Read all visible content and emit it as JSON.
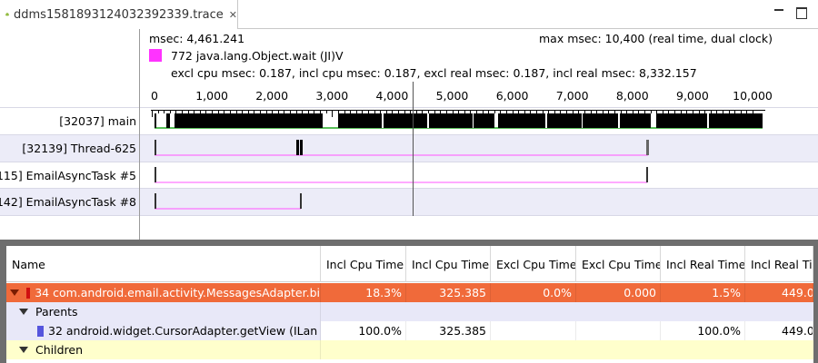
{
  "tab": {
    "title": "ddms1581893124032392339.trace",
    "close_glyph": "✕"
  },
  "info": {
    "msec": "msec: 4,461.241",
    "max_msec": "max msec: 10,400 (real time, dual clock)",
    "method": "772 java.lang.Object.wait (JI)V",
    "method_color": "#ff33ff",
    "stats": "excl cpu msec: 0.187, incl cpu msec: 0.187, excl real msec: 0.187, incl real msec: 8,332.157"
  },
  "ruler": {
    "min": 0,
    "max": 10400,
    "ticks": [
      {
        "value": 0,
        "label": "0"
      },
      {
        "value": 1000,
        "label": "1,000"
      },
      {
        "value": 2000,
        "label": "2,000"
      },
      {
        "value": 3000,
        "label": "3,000"
      },
      {
        "value": 4000,
        "label": "4,000"
      },
      {
        "value": 5000,
        "label": "5,000"
      },
      {
        "value": 6000,
        "label": "6,000"
      },
      {
        "value": 7000,
        "label": "7,000"
      },
      {
        "value": 8000,
        "label": "8,000"
      },
      {
        "value": 9000,
        "label": "9,000"
      },
      {
        "value": 10000,
        "label": "10,000"
      }
    ]
  },
  "threads": [
    {
      "label": "[32037] main"
    },
    {
      "label": "[32139] Thread-625"
    },
    {
      "label": "115] EmailAsyncTask #5"
    },
    {
      "label": "142] EmailAsyncTask #8"
    }
  ],
  "table": {
    "columns": [
      {
        "label": "Name"
      },
      {
        "label": "Incl Cpu Time"
      },
      {
        "label": "Incl Cpu Time"
      },
      {
        "label": "Excl Cpu Time"
      },
      {
        "label": "Excl Cpu Time"
      },
      {
        "label": "Incl Real Time"
      },
      {
        "label": "Incl Real Ti"
      }
    ],
    "rows": [
      {
        "name": "34 com.android.email.activity.MessagesAdapter.bi",
        "c1": "18.3%",
        "c2": "325.385",
        "c3": "0.0%",
        "c4": "0.000",
        "c5": "1.5%",
        "c6": "449.0",
        "color": "#d01010"
      },
      {
        "name": "Parents"
      },
      {
        "name": "32 android.widget.CursorAdapter.getView (ILan",
        "c1": "100.0%",
        "c2": "325.385",
        "c3": "",
        "c4": "",
        "c5": "100.0%",
        "c6": "449.0",
        "color": "#5555dd"
      },
      {
        "name": "Children"
      }
    ]
  }
}
